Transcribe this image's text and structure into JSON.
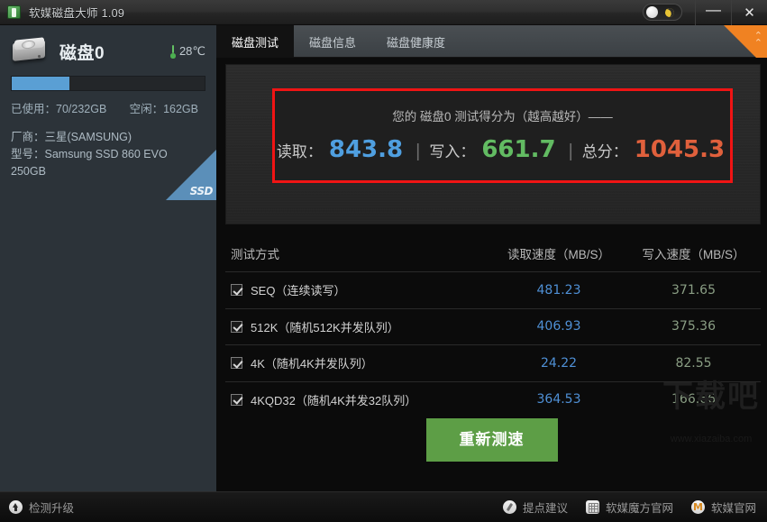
{
  "window": {
    "title": "软媒磁盘大师 1.09",
    "app_icon": "app-icon",
    "theme_toggle": "day-night-toggle",
    "minimize_label": "—",
    "close_label": "✕"
  },
  "sidebar": {
    "disk_name": "磁盘0",
    "temperature": "28℃",
    "usage_percent": 30,
    "used_label": "已使用：70/232GB",
    "free_label": "空闲：162GB",
    "vendor_label": "厂商：三星(SAMSUNG)",
    "model_label": "型号：Samsung SSD 860 EVO 250GB",
    "ribbon_text": "SSD",
    "bar_color": "#5a9fd4"
  },
  "tabs": [
    {
      "label": "磁盘测试",
      "active": true
    },
    {
      "label": "磁盘信息",
      "active": false
    },
    {
      "label": "磁盘健康度",
      "active": false
    }
  ],
  "corner": {
    "name": "collapse-corner",
    "chevron": "⌃",
    "color": "#f08222"
  },
  "score": {
    "caption": "您的 磁盘0 测试得分为（越高越好）——",
    "read_label": "读取：",
    "read_value": "843.8",
    "read_color": "#4f9fe0",
    "write_label": "写入：",
    "write_value": "661.7",
    "write_color": "#62bb62",
    "total_label": "总分：",
    "total_value": "1045.3",
    "total_color": "#e0603c",
    "separator": "|",
    "border_color": "#f01414"
  },
  "table": {
    "headers": {
      "method": "测试方式",
      "read": "读取速度（MB/S）",
      "write": "写入速度（MB/S）"
    },
    "rows": [
      {
        "checked": true,
        "method": "SEQ（连续读写）",
        "read": "481.23",
        "write": "371.65"
      },
      {
        "checked": true,
        "method": "512K（随机512K并发队列）",
        "read": "406.93",
        "write": "375.36"
      },
      {
        "checked": true,
        "method": "4K（随机4K并发队列）",
        "read": "24.22",
        "write": "82.55"
      },
      {
        "checked": true,
        "method": "4KQD32（随机4K并发32队列）",
        "read": "364.53",
        "write": "166.66"
      }
    ]
  },
  "retest_button": {
    "label": "重新测速",
    "color": "#5d9e46"
  },
  "watermark": {
    "big": "下载吧",
    "small": "www.xiazaiba.com"
  },
  "statusbar": {
    "update_label": "检测升级",
    "links": [
      {
        "label": "提点建议",
        "icon": "pen-icon"
      },
      {
        "label": "软媒魔方官网",
        "icon": "grid-icon"
      },
      {
        "label": "软媒官网",
        "icon": "m-logo-icon"
      }
    ]
  }
}
